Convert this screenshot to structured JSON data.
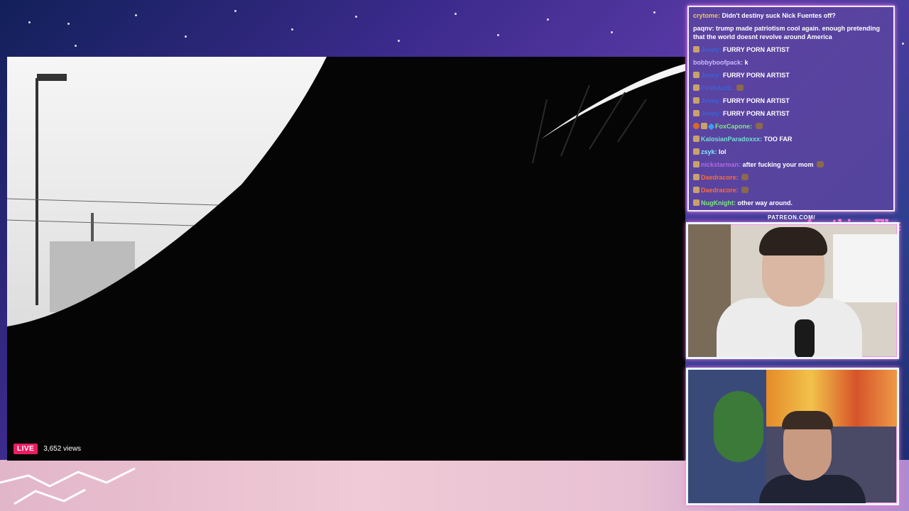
{
  "stream": {
    "live_label": "LIVE",
    "views": "3,652 views"
  },
  "overlay": {
    "patreon_text": "PATREON.COM/",
    "logo_text": "Anything Else?"
  },
  "chat": {
    "messages": [
      {
        "user": "crytome:",
        "text": "Didn't destiny suck Nick Fuentes off?",
        "user_color": "#f0c36a"
      },
      {
        "user": "paqnv:",
        "text": "trump made patriotism cool again. enough pretending that the world doesnt revolve around America",
        "user_color": "#ffffff"
      },
      {
        "user": "Jovey:",
        "text": "FURRY PORN ARTIST",
        "user_color": "#3a63d8"
      },
      {
        "user": "bobbyboofpack:",
        "text": "k",
        "user_color": "#c9b8ff"
      },
      {
        "user": "Jovey:",
        "text": "FURRY PORN ARTIST",
        "user_color": "#3a63d8"
      },
      {
        "user": "FirebAut1:",
        "text": "",
        "user_color": "#3a63d8"
      },
      {
        "user": "Jovey:",
        "text": "FURRY PORN ARTIST",
        "user_color": "#3a63d8"
      },
      {
        "user": "Jovey:",
        "text": "FURRY PORN ARTIST",
        "user_color": "#3a63d8"
      },
      {
        "user": "FoxCapone:",
        "text": "",
        "user_color": "#7ee87e"
      },
      {
        "user": "KalosianParadoxxx:",
        "text": "TOO FAR",
        "user_color": "#6fe0d0"
      },
      {
        "user": "zsyk:",
        "text": "lol",
        "user_color": "#7fe8ff"
      },
      {
        "user": "nickstarman:",
        "text": "after fucking your mom",
        "user_color": "#b06ae0"
      },
      {
        "user": "Daedracore:",
        "text": "",
        "user_color": "#ff6a3a"
      },
      {
        "user": "Daedracore:",
        "text": "",
        "user_color": "#ff6a3a"
      },
      {
        "user": "NugKnight:",
        "text": "other way around.",
        "user_color": "#7ee87e"
      }
    ]
  }
}
